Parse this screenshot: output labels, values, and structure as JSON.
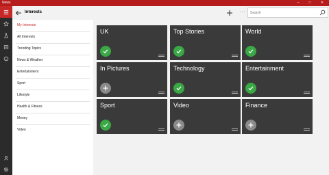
{
  "window": {
    "app_title": "News",
    "controls": [
      "–",
      "□",
      "✕"
    ]
  },
  "header": {
    "title": "Interests",
    "more_label": "···"
  },
  "search": {
    "placeholder": "Search"
  },
  "rail": {
    "icons": [
      "hamburger-icon",
      "star-icon",
      "flask-icon",
      "news-icon",
      "smiley-icon",
      "person-icon",
      "gear-icon"
    ]
  },
  "menu": {
    "items": [
      {
        "label": "My Interests",
        "active": true
      },
      {
        "label": "All Interests"
      },
      {
        "label": "Trending Topics"
      },
      {
        "label": "News & Weather"
      },
      {
        "label": "Entertainment"
      },
      {
        "label": "Sport"
      },
      {
        "label": "Lifestyle"
      },
      {
        "label": "Health & Fitness"
      },
      {
        "label": "Money"
      },
      {
        "label": "Video"
      }
    ]
  },
  "tiles": [
    {
      "name": "UK",
      "selected": true
    },
    {
      "name": "Top Stories",
      "selected": true
    },
    {
      "name": "World",
      "selected": true
    },
    {
      "name": "In Pictures",
      "selected": false
    },
    {
      "name": "Technology",
      "selected": true
    },
    {
      "name": "Entertainment",
      "selected": true
    },
    {
      "name": "Sport",
      "selected": true
    },
    {
      "name": "Video",
      "selected": false
    },
    {
      "name": "Finance",
      "selected": false
    }
  ],
  "colors": {
    "accent": "#c62828",
    "check": "#39a845",
    "tile": "#3a3a3a"
  }
}
